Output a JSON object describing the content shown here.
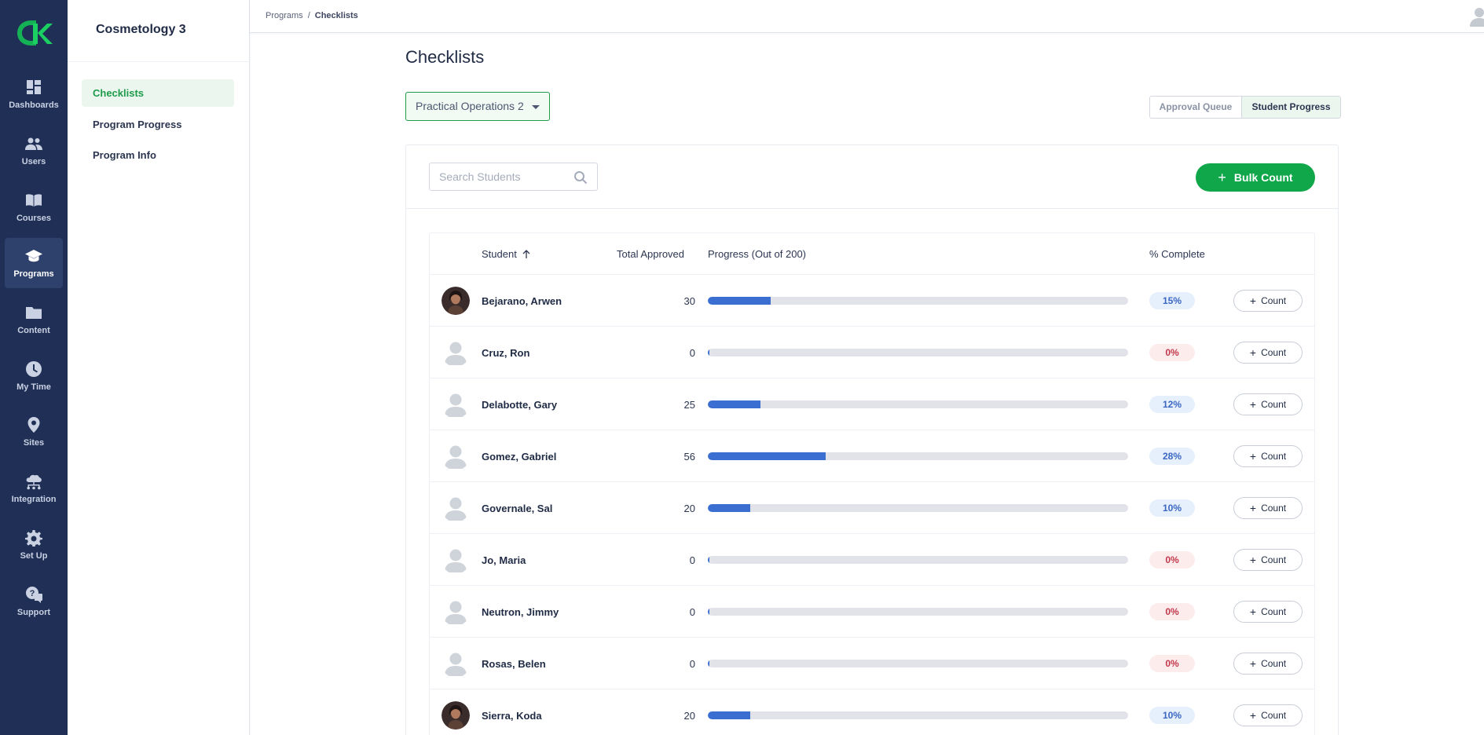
{
  "rail": {
    "items": [
      {
        "label": "Dashboards",
        "icon": "dashboard-icon"
      },
      {
        "label": "Users",
        "icon": "users-icon"
      },
      {
        "label": "Courses",
        "icon": "book-icon"
      },
      {
        "label": "Programs",
        "icon": "graduation-cap-icon"
      },
      {
        "label": "Content",
        "icon": "folder-icon"
      },
      {
        "label": "My Time",
        "icon": "clock-icon"
      },
      {
        "label": "Sites",
        "icon": "location-pin-icon"
      },
      {
        "label": "Integration",
        "icon": "cloud-network-icon"
      },
      {
        "label": "Set Up",
        "icon": "gear-icon"
      },
      {
        "label": "Support",
        "icon": "help-chat-icon"
      }
    ],
    "active": "Programs"
  },
  "sidebar": {
    "title": "Cosmetology 3",
    "items": [
      {
        "label": "Checklists"
      },
      {
        "label": "Program Progress"
      },
      {
        "label": "Program Info"
      }
    ]
  },
  "breadcrumb": {
    "parent": "Programs",
    "separator": "/",
    "current": "Checklists"
  },
  "page": {
    "title": "Checklists",
    "checklist_select": "Practical Operations 2",
    "view_toggle": {
      "approval_queue": "Approval Queue",
      "student_progress": "Student Progress",
      "selected": "Student Progress"
    }
  },
  "toolbar": {
    "search_placeholder": "Search Students",
    "bulk_count": "Bulk Count",
    "bulk_plus": "+"
  },
  "table": {
    "headers": {
      "student": "Student",
      "total_approved": "Total Approved",
      "progress": "Progress (Out of 200)",
      "percent": "% Complete"
    },
    "count_label": "Count",
    "count_plus": "+",
    "rows": [
      {
        "name": "Bejarano, Arwen",
        "total": "30",
        "progress": 0.15,
        "percent": "15%",
        "photo": true
      },
      {
        "name": "Cruz, Ron",
        "total": "0",
        "progress": 0,
        "percent": "0%",
        "photo": false
      },
      {
        "name": "Delabotte, Gary",
        "total": "25",
        "progress": 0.125,
        "percent": "12%",
        "photo": false
      },
      {
        "name": "Gomez, Gabriel",
        "total": "56",
        "progress": 0.28,
        "percent": "28%",
        "photo": false
      },
      {
        "name": "Governale, Sal",
        "total": "20",
        "progress": 0.1,
        "percent": "10%",
        "photo": false
      },
      {
        "name": "Jo, Maria",
        "total": "0",
        "progress": 0,
        "percent": "0%",
        "photo": false
      },
      {
        "name": "Neutron, Jimmy",
        "total": "0",
        "progress": 0,
        "percent": "0%",
        "photo": false
      },
      {
        "name": "Rosas, Belen",
        "total": "0",
        "progress": 0,
        "percent": "0%",
        "photo": false
      },
      {
        "name": "Sierra, Koda",
        "total": "20",
        "progress": 0.1,
        "percent": "10%",
        "photo": true
      }
    ]
  },
  "colors": {
    "rail_bg": "#1f2f55",
    "accent_green": "#10a64a",
    "progress_blue": "#3a6fd1"
  }
}
